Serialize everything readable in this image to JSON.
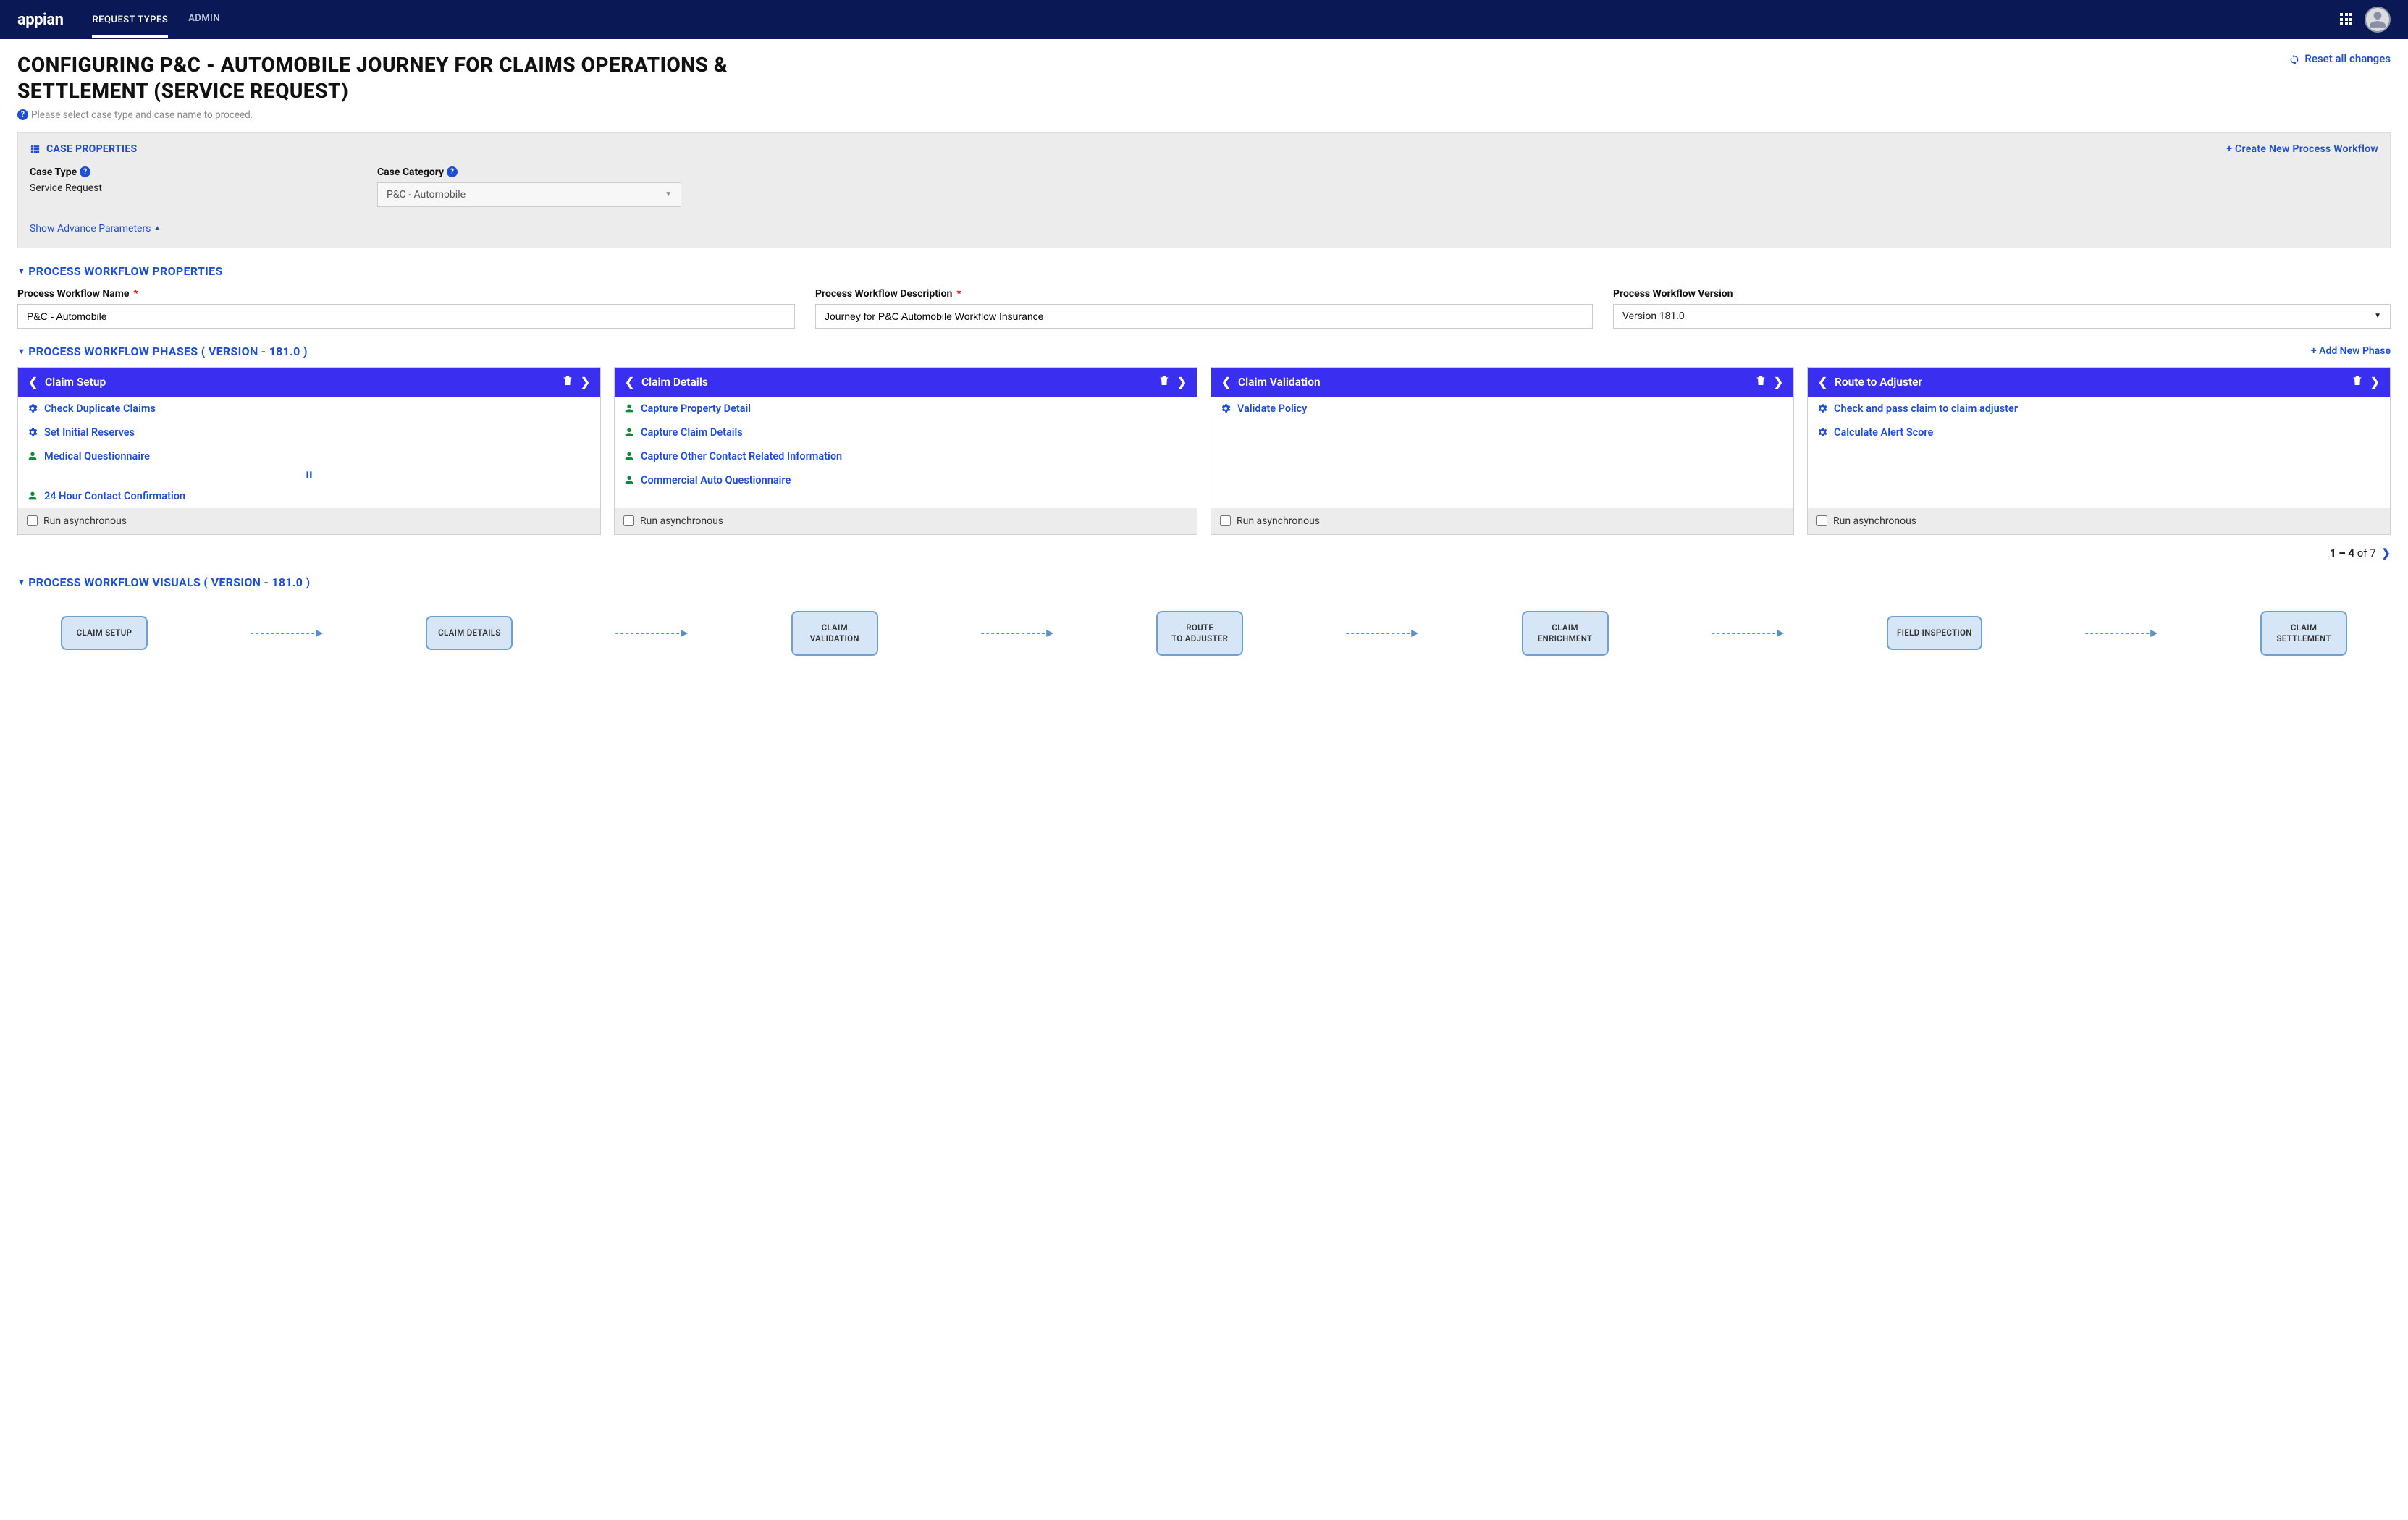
{
  "header": {
    "brand": "appian",
    "nav": [
      "REQUEST TYPES",
      "ADMIN"
    ],
    "active_nav": 0
  },
  "page": {
    "title": "CONFIGURING P&C - AUTOMOBILE JOURNEY FOR CLAIMS OPERATIONS & SETTLEMENT (SERVICE REQUEST)",
    "hint": "Please select case type and case name to proceed.",
    "reset_label": "Reset all changes"
  },
  "case_properties": {
    "header": "CASE PROPERTIES",
    "create_link": "+ Create New Process Workflow",
    "case_type_label": "Case Type",
    "case_type_value": "Service Request",
    "case_category_label": "Case Category",
    "case_category_value": "P&C - Automobile",
    "show_advance": "Show Advance Parameters"
  },
  "workflow_props": {
    "header": "PROCESS WORKFLOW PROPERTIES",
    "name_label": "Process Workflow Name",
    "name_value": "P&C - Automobile",
    "desc_label": "Process Workflow Description",
    "desc_value": "Journey for P&C Automobile Workflow Insurance",
    "version_label": "Process Workflow Version",
    "version_value": "Version 181.0"
  },
  "phases": {
    "header": "PROCESS WORKFLOW PHASES ( VERSION - 181.0 )",
    "add_link": "+ Add New Phase",
    "async_label": "Run asynchronous",
    "pager": {
      "range": "1 – 4",
      "of_label": "of",
      "total": "7"
    },
    "cards": [
      {
        "title": "Claim Setup",
        "steps": [
          {
            "type": "gear",
            "label": "Check Duplicate Claims"
          },
          {
            "type": "gear",
            "label": "Set Initial Reserves"
          },
          {
            "type": "person",
            "label": "Medical  Questionnaire"
          },
          {
            "type": "pause"
          },
          {
            "type": "person",
            "label": "24 Hour Contact Confirmation"
          }
        ]
      },
      {
        "title": "Claim Details",
        "steps": [
          {
            "type": "person",
            "label": "Capture Property Detail"
          },
          {
            "type": "person",
            "label": "Capture Claim Details"
          },
          {
            "type": "person",
            "label": "Capture Other Contact Related  Information"
          },
          {
            "type": "person",
            "label": "Commercial Auto Questionnaire"
          }
        ]
      },
      {
        "title": "Claim Validation",
        "steps": [
          {
            "type": "gear",
            "label": "Validate Policy"
          }
        ]
      },
      {
        "title": "Route to Adjuster",
        "steps": [
          {
            "type": "gear",
            "label": "Check and pass claim to claim adjuster"
          },
          {
            "type": "gear",
            "label": "Calculate Alert Score"
          }
        ]
      }
    ]
  },
  "visuals": {
    "header": "PROCESS WORKFLOW VISUALS ( VERSION - 181.0 )",
    "nodes": [
      "CLAIM SETUP",
      "CLAIM DETAILS",
      "CLAIM VALIDATION",
      "ROUTE TO ADJUSTER",
      "CLAIM ENRICHMENT",
      "FIELD INSPECTION",
      "CLAIM SETTLEMENT"
    ]
  }
}
